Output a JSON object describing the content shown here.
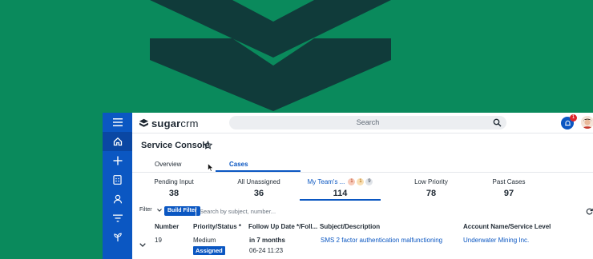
{
  "colors": {
    "backdrop": "#0a8a5c",
    "chevron": "#103b3a",
    "brand_blue": "#0b57c2",
    "rail_active": "#0a47a3",
    "danger": "#e0262b"
  },
  "rail": {
    "icons": [
      "menu-icon",
      "home-icon",
      "plus-icon",
      "calculator-icon",
      "user-icon",
      "filter-icon",
      "plant-icon"
    ]
  },
  "topbar": {
    "logo": {
      "brand": "sugar",
      "suffix": "crm"
    },
    "search": {
      "placeholder": "Search"
    },
    "notifications": {
      "count": "1"
    }
  },
  "page": {
    "title": "Service Console",
    "tabs": [
      {
        "label": "Overview",
        "active": false
      },
      {
        "label": "Cases",
        "active": true
      }
    ]
  },
  "stats": [
    {
      "label": "Pending Input",
      "value": "38"
    },
    {
      "label": "All Unassigned",
      "value": "36"
    },
    {
      "label": "My Team's ...",
      "value": "114",
      "active": true,
      "pills": [
        "1",
        "1",
        "9"
      ]
    },
    {
      "label": "Low Priority",
      "value": "78"
    },
    {
      "label": "Past Cases",
      "value": "97"
    }
  ],
  "filter": {
    "label": "Filter",
    "build_button": "Build Filter",
    "search_placeholder": "Search by subject, number..."
  },
  "table": {
    "headers": {
      "number": "Number",
      "priority": "Priority/Status *",
      "follow_up": "Follow Up Date */Foll...",
      "subject": "Subject/Description",
      "account": "Account Name/Service Level"
    },
    "rows": [
      {
        "number": "19",
        "priority": "Medium",
        "status": "Assigned",
        "follow_up": "in 7 months",
        "follow_up_date": "06-24 11:23",
        "subject": "SMS 2 factor authentication malfunctioning",
        "account": "Underwater Mining Inc."
      }
    ]
  }
}
